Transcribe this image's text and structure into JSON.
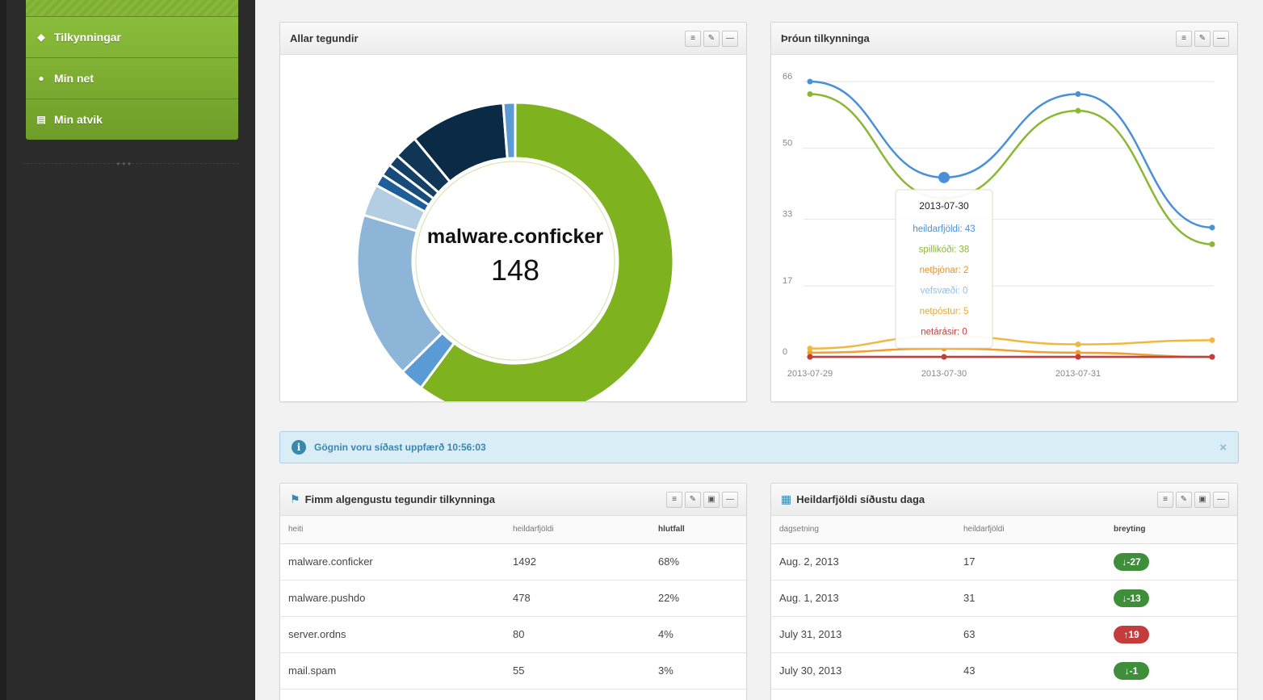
{
  "sidebar": {
    "items": [
      {
        "label": "Tilkynningar",
        "icon": "tags-icon"
      },
      {
        "label": "Min net",
        "icon": "globe-icon"
      },
      {
        "label": "Min atvik",
        "icon": "list-icon"
      }
    ]
  },
  "donut_widget": {
    "title": "Allar tegundir",
    "center_label": "malware.conficker",
    "center_value": "148",
    "chart_data": {
      "type": "pie",
      "slices": [
        {
          "value": 148,
          "color": "#7fb21f"
        },
        {
          "value": 6,
          "color": "#5b9bd5"
        },
        {
          "value": 42,
          "color": "#8cb5d8"
        },
        {
          "value": 8,
          "color": "#b3cde3"
        },
        {
          "value": 3,
          "color": "#1f5f99"
        },
        {
          "value": 3,
          "color": "#184a7a"
        },
        {
          "value": 3,
          "color": "#163f66"
        },
        {
          "value": 6,
          "color": "#103555"
        },
        {
          "value": 24,
          "color": "#0b2a45"
        },
        {
          "value": 3,
          "color": "#5b9bd5"
        }
      ]
    }
  },
  "line_widget": {
    "title": "Þróun tilkynninga",
    "chart_data": {
      "type": "line",
      "x": [
        "2013-07-29",
        "2013-07-30",
        "2013-07-31",
        "2013-08-01"
      ],
      "x_ticks": [
        "2013-07-29",
        "2013-07-30",
        "2013-07-31"
      ],
      "y_ticks": [
        "0",
        "17",
        "33",
        "50",
        "66"
      ],
      "ylim": [
        0,
        66
      ],
      "series": [
        {
          "name": "heildarfjöldi",
          "color": "#4a90d9",
          "values": [
            66,
            43,
            63,
            31
          ]
        },
        {
          "name": "spillikóði",
          "color": "#8ab832",
          "values": [
            63,
            38,
            59,
            27
          ]
        },
        {
          "name": "netþjónar",
          "color": "#f0a030",
          "values": [
            1,
            2,
            1,
            0
          ]
        },
        {
          "name": "vefsvæði",
          "color": "#8cc0ec",
          "values": [
            0,
            0,
            0,
            0
          ]
        },
        {
          "name": "netpóstur",
          "color": "#f0b840",
          "values": [
            2,
            5,
            3,
            4
          ]
        },
        {
          "name": "netárásir",
          "color": "#c43c3c",
          "values": [
            0,
            0,
            0,
            0
          ]
        }
      ],
      "tooltip": {
        "title": "2013-07-30",
        "lines": [
          {
            "text": "heildarfjöldi: 43",
            "color": "#4a90d9"
          },
          {
            "text": "spillikóði: 38",
            "color": "#8ab832"
          },
          {
            "text": "netþjónar: 2",
            "color": "#e8902a"
          },
          {
            "text": "vefsvæði: 0",
            "color": "#8cc0ec"
          },
          {
            "text": "netpóstur: 5",
            "color": "#e6a82a"
          },
          {
            "text": "netárásir: 0",
            "color": "#c43c3c"
          }
        ]
      }
    }
  },
  "alert": {
    "text": "Gögnin voru síðast uppfærð 10:56:03",
    "close": "×"
  },
  "top_types": {
    "title": "Fimm algengustu tegundir tilkynninga",
    "columns": [
      "heiti",
      "heildarfjöldi",
      "hlutfall"
    ],
    "rows": [
      [
        "malware.conficker",
        "1492",
        "68%"
      ],
      [
        "malware.pushdo",
        "478",
        "22%"
      ],
      [
        "server.ordns",
        "80",
        "4%"
      ],
      [
        "mail.spam",
        "55",
        "3%"
      ]
    ]
  },
  "daily_totals": {
    "title": "Heildarfjöldi síðustu daga",
    "columns": [
      "dagsetning",
      "heildarfjöldi",
      "breyting"
    ],
    "rows": [
      {
        "date": "Aug. 2, 2013",
        "total": "17",
        "change": "-27",
        "dir": "down"
      },
      {
        "date": "Aug. 1, 2013",
        "total": "31",
        "change": "-13",
        "dir": "down"
      },
      {
        "date": "July 31, 2013",
        "total": "63",
        "change": "19",
        "dir": "up"
      },
      {
        "date": "July 30, 2013",
        "total": "43",
        "change": "-1",
        "dir": "down"
      }
    ]
  }
}
